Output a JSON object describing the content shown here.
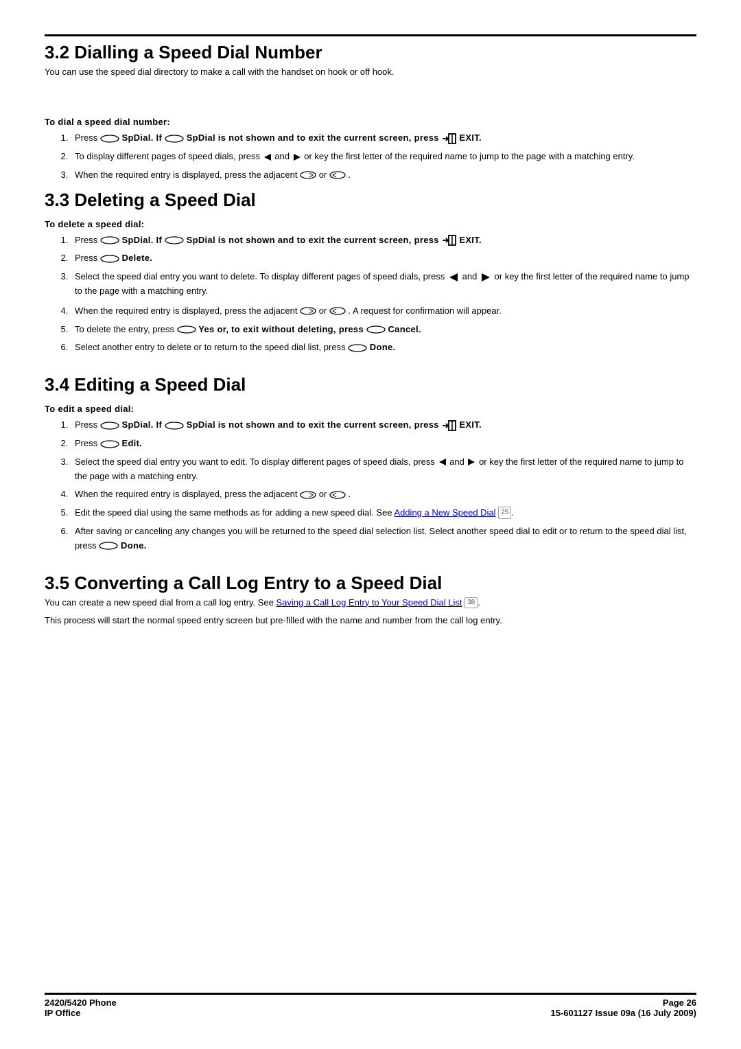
{
  "sections": {
    "s32": {
      "title": "3.2 Dialling a Speed Dial Number",
      "intro": "You can use the speed dial directory to make a call with the handset on hook or off hook.",
      "lead": "To dial a speed dial number:",
      "li1a": "Press ",
      "li1b": " SpDial. If ",
      "li1c": " SpDial is not shown and to exit the current screen, press ",
      "li1d": " EXIT.",
      "li2a": "To display different pages of speed dials, press ",
      "li2b": " and ",
      "li2c": " or key the first letter of the required name to jump to the page with a matching entry.",
      "li3a": "When the required entry is displayed, press the adjacent ",
      "li3b": " or ",
      "li3c": "."
    },
    "s33": {
      "title": "3.3 Deleting a Speed Dial",
      "lead": "To delete a speed dial:",
      "li1a": "Press ",
      "li1b": " SpDial. If ",
      "li1c": " SpDial is not shown and to exit the current screen, press ",
      "li1d": " EXIT.",
      "li2a": "Press ",
      "li2b": " Delete.",
      "li3a": "Select the speed dial entry you want to delete. To display different pages of speed dials, press ",
      "li3b": " and ",
      "li3c": " or key the first letter of the required name to jump to the page with a matching entry.",
      "li4a": "When the required entry is displayed, press the adjacent ",
      "li4b": " or ",
      "li4c": ". A request for confirmation will appear.",
      "li5a": "To delete the entry, press ",
      "li5b": " Yes or, to exit without deleting, press ",
      "li5c": " Cancel.",
      "li6a": "Select another entry to delete or to return to the speed dial list, press ",
      "li6b": " Done."
    },
    "s34": {
      "title": "3.4 Editing a Speed Dial",
      "lead": "To edit a speed dial:",
      "li1a": "Press ",
      "li1b": " SpDial. If ",
      "li1c": " SpDial is not shown and to exit the current screen, press ",
      "li1d": " EXIT.",
      "li2a": "Press ",
      "li2b": " Edit.",
      "li3a": "Select the speed dial entry you want to edit. To display different pages of speed dials, press ",
      "li3b": " and ",
      "li3c": " or key the first letter of the required name to jump to the page with a matching entry.",
      "li4a": "When the required entry is displayed, press the adjacent ",
      "li4b": " or ",
      "li4c": ".",
      "li5a": "Edit the speed dial using the same methods as for adding a new speed dial. See ",
      "li5link": "Adding a New Speed Dial",
      "li5ref": "25",
      "li5b": ".",
      "li6a": "After saving or canceling any changes you will be returned to the speed dial selection list. Select another speed dial to edit or to return to the speed dial list, press ",
      "li6b": " Done."
    },
    "s35": {
      "title": "3.5 Converting a Call Log Entry to a Speed Dial",
      "p1a": "You can create a new speed dial from a call log entry. See ",
      "p1link": "Saving a Call Log Entry to Your Speed Dial List",
      "p1ref": "38",
      "p1b": ".",
      "p2": "This process will start the normal speed entry screen but pre-filled with the name and number from the call log entry."
    }
  },
  "footer": {
    "left1": "2420/5420 Phone",
    "left2": "IP Office",
    "right1": "Page 26",
    "right2": "15-601127 Issue 09a (16 July 2009)"
  }
}
